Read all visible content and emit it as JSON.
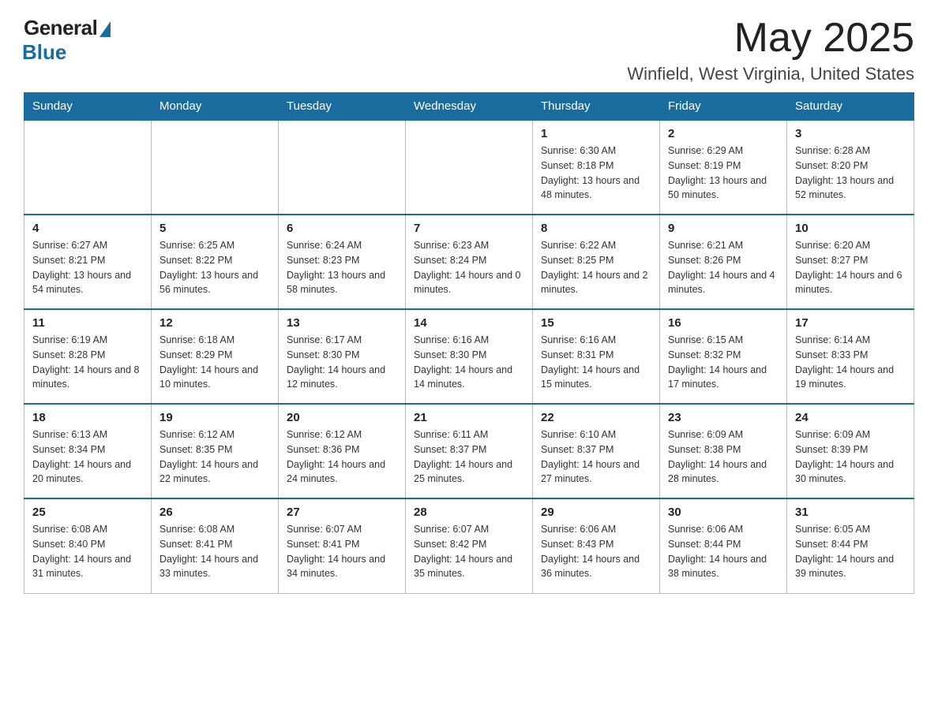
{
  "header": {
    "logo_general": "General",
    "logo_blue": "Blue",
    "month": "May 2025",
    "location": "Winfield, West Virginia, United States"
  },
  "days_of_week": [
    "Sunday",
    "Monday",
    "Tuesday",
    "Wednesday",
    "Thursday",
    "Friday",
    "Saturday"
  ],
  "weeks": [
    [
      {
        "day": "",
        "info": ""
      },
      {
        "day": "",
        "info": ""
      },
      {
        "day": "",
        "info": ""
      },
      {
        "day": "",
        "info": ""
      },
      {
        "day": "1",
        "info": "Sunrise: 6:30 AM\nSunset: 8:18 PM\nDaylight: 13 hours and 48 minutes."
      },
      {
        "day": "2",
        "info": "Sunrise: 6:29 AM\nSunset: 8:19 PM\nDaylight: 13 hours and 50 minutes."
      },
      {
        "day": "3",
        "info": "Sunrise: 6:28 AM\nSunset: 8:20 PM\nDaylight: 13 hours and 52 minutes."
      }
    ],
    [
      {
        "day": "4",
        "info": "Sunrise: 6:27 AM\nSunset: 8:21 PM\nDaylight: 13 hours and 54 minutes."
      },
      {
        "day": "5",
        "info": "Sunrise: 6:25 AM\nSunset: 8:22 PM\nDaylight: 13 hours and 56 minutes."
      },
      {
        "day": "6",
        "info": "Sunrise: 6:24 AM\nSunset: 8:23 PM\nDaylight: 13 hours and 58 minutes."
      },
      {
        "day": "7",
        "info": "Sunrise: 6:23 AM\nSunset: 8:24 PM\nDaylight: 14 hours and 0 minutes."
      },
      {
        "day": "8",
        "info": "Sunrise: 6:22 AM\nSunset: 8:25 PM\nDaylight: 14 hours and 2 minutes."
      },
      {
        "day": "9",
        "info": "Sunrise: 6:21 AM\nSunset: 8:26 PM\nDaylight: 14 hours and 4 minutes."
      },
      {
        "day": "10",
        "info": "Sunrise: 6:20 AM\nSunset: 8:27 PM\nDaylight: 14 hours and 6 minutes."
      }
    ],
    [
      {
        "day": "11",
        "info": "Sunrise: 6:19 AM\nSunset: 8:28 PM\nDaylight: 14 hours and 8 minutes."
      },
      {
        "day": "12",
        "info": "Sunrise: 6:18 AM\nSunset: 8:29 PM\nDaylight: 14 hours and 10 minutes."
      },
      {
        "day": "13",
        "info": "Sunrise: 6:17 AM\nSunset: 8:30 PM\nDaylight: 14 hours and 12 minutes."
      },
      {
        "day": "14",
        "info": "Sunrise: 6:16 AM\nSunset: 8:30 PM\nDaylight: 14 hours and 14 minutes."
      },
      {
        "day": "15",
        "info": "Sunrise: 6:16 AM\nSunset: 8:31 PM\nDaylight: 14 hours and 15 minutes."
      },
      {
        "day": "16",
        "info": "Sunrise: 6:15 AM\nSunset: 8:32 PM\nDaylight: 14 hours and 17 minutes."
      },
      {
        "day": "17",
        "info": "Sunrise: 6:14 AM\nSunset: 8:33 PM\nDaylight: 14 hours and 19 minutes."
      }
    ],
    [
      {
        "day": "18",
        "info": "Sunrise: 6:13 AM\nSunset: 8:34 PM\nDaylight: 14 hours and 20 minutes."
      },
      {
        "day": "19",
        "info": "Sunrise: 6:12 AM\nSunset: 8:35 PM\nDaylight: 14 hours and 22 minutes."
      },
      {
        "day": "20",
        "info": "Sunrise: 6:12 AM\nSunset: 8:36 PM\nDaylight: 14 hours and 24 minutes."
      },
      {
        "day": "21",
        "info": "Sunrise: 6:11 AM\nSunset: 8:37 PM\nDaylight: 14 hours and 25 minutes."
      },
      {
        "day": "22",
        "info": "Sunrise: 6:10 AM\nSunset: 8:37 PM\nDaylight: 14 hours and 27 minutes."
      },
      {
        "day": "23",
        "info": "Sunrise: 6:09 AM\nSunset: 8:38 PM\nDaylight: 14 hours and 28 minutes."
      },
      {
        "day": "24",
        "info": "Sunrise: 6:09 AM\nSunset: 8:39 PM\nDaylight: 14 hours and 30 minutes."
      }
    ],
    [
      {
        "day": "25",
        "info": "Sunrise: 6:08 AM\nSunset: 8:40 PM\nDaylight: 14 hours and 31 minutes."
      },
      {
        "day": "26",
        "info": "Sunrise: 6:08 AM\nSunset: 8:41 PM\nDaylight: 14 hours and 33 minutes."
      },
      {
        "day": "27",
        "info": "Sunrise: 6:07 AM\nSunset: 8:41 PM\nDaylight: 14 hours and 34 minutes."
      },
      {
        "day": "28",
        "info": "Sunrise: 6:07 AM\nSunset: 8:42 PM\nDaylight: 14 hours and 35 minutes."
      },
      {
        "day": "29",
        "info": "Sunrise: 6:06 AM\nSunset: 8:43 PM\nDaylight: 14 hours and 36 minutes."
      },
      {
        "day": "30",
        "info": "Sunrise: 6:06 AM\nSunset: 8:44 PM\nDaylight: 14 hours and 38 minutes."
      },
      {
        "day": "31",
        "info": "Sunrise: 6:05 AM\nSunset: 8:44 PM\nDaylight: 14 hours and 39 minutes."
      }
    ]
  ]
}
